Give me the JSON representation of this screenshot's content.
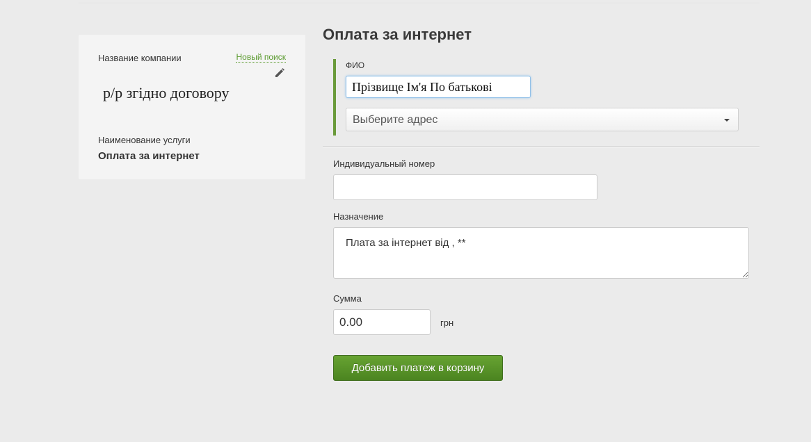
{
  "sidebar": {
    "company_label": "Название компании",
    "new_search_link": "Новый поиск",
    "company_name": "р/р згідно договору",
    "service_label": "Наименование услуги",
    "service_name": "Оплата за интернет",
    "edit_icon": "pencil-icon"
  },
  "main": {
    "title": "Оплата за интернет",
    "fio": {
      "label": "ФИО",
      "value": "Прізвище Ім'я По батькові"
    },
    "address": {
      "selected": "Выберите адрес"
    },
    "individual_number": {
      "label": "Индивидуальный номер",
      "value": ""
    },
    "purpose": {
      "label": "Назначение",
      "value": "Плата за інтернет від , **"
    },
    "amount": {
      "label": "Сумма",
      "value": "0.00",
      "currency": "грн"
    },
    "submit_label": "Добавить платеж в корзину"
  },
  "colors": {
    "accent_green": "#5a9a2e",
    "button_green": "#4b8420",
    "background": "#ebebeb"
  }
}
